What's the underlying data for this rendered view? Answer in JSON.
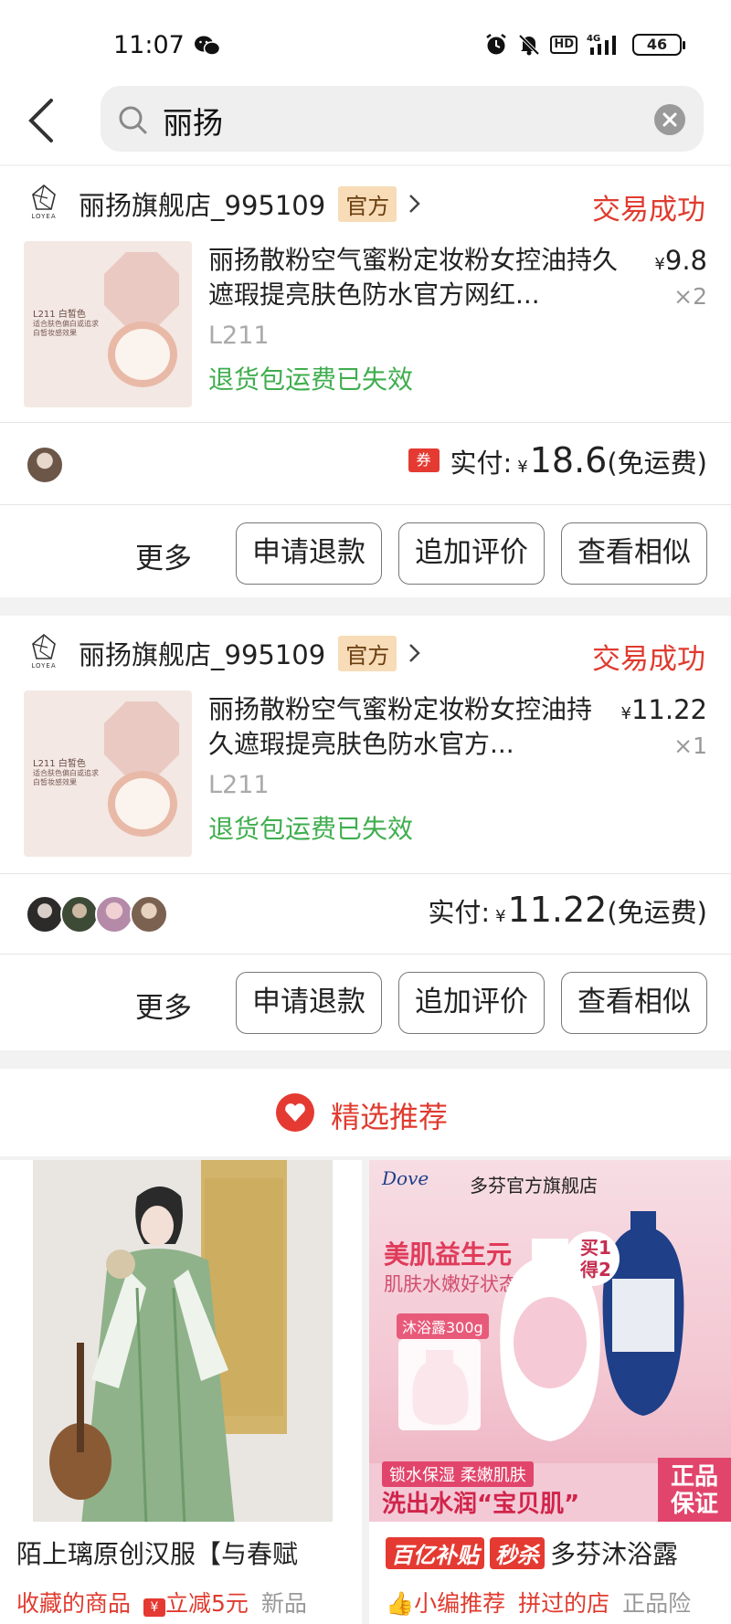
{
  "status": {
    "time": "11:07",
    "battery": "46",
    "hd": "HD",
    "net": "4G"
  },
  "search": {
    "query": "丽扬"
  },
  "orders": [
    {
      "shop": "丽扬旗舰店_995109",
      "tag": "官方",
      "state": "交易成功",
      "brand": "LOYEA",
      "thumb_label": "L211 白皙色",
      "thumb_sub": "适合肤色偏白或追求\n白皙妆感效果",
      "title": "丽扬散粉空气蜜粉定妆粉女控油持久遮瑕提亮肤色防水官方网红...",
      "price_symbol": "¥",
      "price": "9.8",
      "qty": "×2",
      "sku": "L211",
      "notice": "退货包运费已失效",
      "coupon": "券",
      "paid_label": "实付:",
      "paid_symbol": "¥",
      "paid": "18.6",
      "paid_note": "(免运费)",
      "more": "更多",
      "btn_refund": "申请退款",
      "btn_review": "追加评价",
      "btn_similar": "查看相似"
    },
    {
      "shop": "丽扬旗舰店_995109",
      "tag": "官方",
      "state": "交易成功",
      "brand": "LOYEA",
      "thumb_label": "L211 白皙色",
      "thumb_sub": "适合肤色偏白或追求\n白皙妆感效果",
      "title": "丽扬散粉空气蜜粉定妆粉女控油持久遮瑕提亮肤色防水官方...",
      "price_symbol": "¥",
      "price": "11.22",
      "qty": "×1",
      "sku": "L211",
      "notice": "退货包运费已失效",
      "paid_label": "实付:",
      "paid_symbol": "¥",
      "paid": "11.22",
      "paid_note": "(免运费)",
      "more": "更多",
      "btn_refund": "申请退款",
      "btn_review": "追加评价",
      "btn_similar": "查看相似"
    }
  ],
  "recommend": {
    "label": "精选推荐",
    "items": [
      {
        "title": "陌上璃原创汉服【与春赋",
        "tags": [
          "收藏的商品",
          "立减5元",
          "新品"
        ]
      },
      {
        "store": "多芬官方旗舰店",
        "brand": "Dove",
        "headline": "美肌益生元",
        "subline": "肌肤水嫩好状态",
        "gift": "沐浴露300g",
        "promo": "买1得2",
        "strip": "锁水保湿 柔嫩肌肤",
        "slogan": "洗出水润“宝贝肌”",
        "guarantee": "正品保证",
        "badge1": "百亿补贴",
        "badge2": "秒杀",
        "title": "多芬沐浴露",
        "tags": [
          "小编推荐",
          "拼过的店",
          "正品险"
        ]
      }
    ]
  },
  "colors": {
    "accent": "#e03b2f",
    "green": "#3fae4e",
    "tag_bg": "#f7dcb7"
  }
}
